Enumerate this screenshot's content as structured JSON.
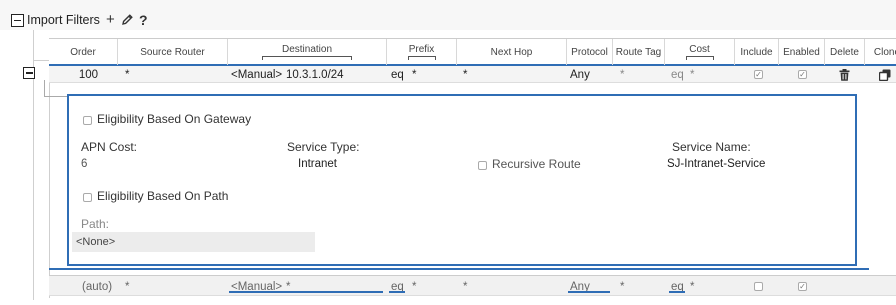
{
  "header": {
    "title": "Import Filters",
    "add_icon": "plus-icon",
    "edit_icon": "pencil-icon",
    "help_label": "?"
  },
  "columns": {
    "order": "Order",
    "source_router": "Source Router",
    "destination": "Destination",
    "prefix": "Prefix",
    "next_hop": "Next Hop",
    "protocol": "Protocol",
    "route_tag": "Route Tag",
    "cost": "Cost",
    "include": "Include",
    "enabled": "Enabled",
    "delete": "Delete",
    "clone": "Clone"
  },
  "row": {
    "order": "100",
    "source_router": "*",
    "destination_mode": "<Manual>",
    "destination_value": "10.3.1.0/24",
    "prefix_op": "eq",
    "prefix_value": "*",
    "next_hop": "*",
    "protocol": "Any",
    "route_tag": "*",
    "cost_op": "eq",
    "cost_value": "*",
    "include": true,
    "enabled": true,
    "delete_icon": "trash-icon",
    "clone_icon": "copy-icon"
  },
  "detail": {
    "gateway_label": "Eligibility Based On Gateway",
    "apn_cost_label": "APN Cost:",
    "apn_cost_value": "6",
    "service_type_label": "Service Type:",
    "service_type_value": "Intranet",
    "recursive_label": "Recursive Route",
    "service_name_label": "Service Name:",
    "service_name_value": "SJ-Intranet-Service",
    "path_elig_label": "Eligibility Based On Path",
    "path_label": "Path:",
    "path_value": "<None>"
  },
  "new_row": {
    "order": "(auto)",
    "source_router": "*",
    "destination_mode": "<Manual>",
    "destination_value": "*",
    "prefix_op": "eq",
    "prefix_value": "*",
    "next_hop": "*",
    "protocol": "Any",
    "route_tag": "*",
    "cost_op": "eq",
    "cost_value": "*",
    "include": false,
    "enabled": true
  },
  "colors": {
    "accent": "#2f6db5"
  }
}
